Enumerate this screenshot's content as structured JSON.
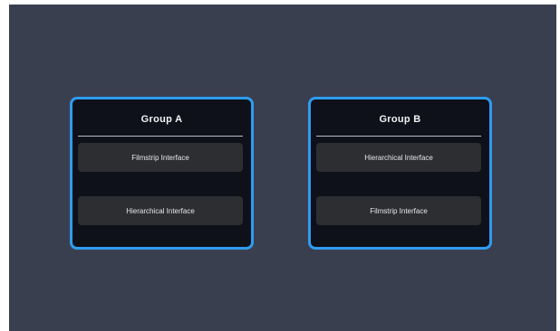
{
  "colors": {
    "background": "#3a3f50",
    "panel": "#0e1119",
    "panel_border": "#2f9cf0",
    "item": "#2d2e31",
    "divider": "#b9bcc4"
  },
  "groups": [
    {
      "title": "Group A",
      "items": [
        {
          "label": "Filmstrip Interface"
        },
        {
          "label": "Hierarchical Interface"
        }
      ]
    },
    {
      "title": "Group B",
      "items": [
        {
          "label": "Hierarchical Interface"
        },
        {
          "label": "Filmstrip Interface"
        }
      ]
    }
  ]
}
